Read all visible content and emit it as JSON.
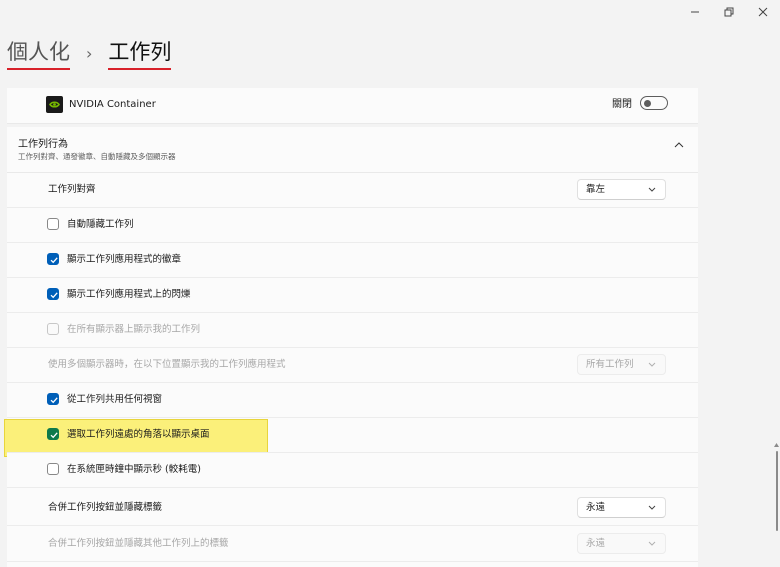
{
  "window": {
    "minimize_glyph": "–",
    "restore_glyph": "❐",
    "close_glyph": "✕"
  },
  "breadcrumb": {
    "parent": "個人化",
    "separator": "›",
    "current": "工作列"
  },
  "nvidia": {
    "label": "NVIDIA Container",
    "toggle_label": "關閉",
    "toggle_on": false,
    "icon": "nvidia-icon"
  },
  "behavior": {
    "title": "工作列行為",
    "subtitle": "工作列對齊、通發徽章、自動隱藏及多個顯示器",
    "expanded": true,
    "alignment": {
      "label": "工作列對齊",
      "value": "靠左"
    },
    "auto_hide": {
      "label": "自動隱藏工作列",
      "checked": false
    },
    "show_badges": {
      "label": "顯示工作列應用程式的徽章",
      "checked": true
    },
    "show_flashing": {
      "label": "顯示工作列應用程式上的閃爍",
      "checked": true
    },
    "all_displays": {
      "label": "在所有顯示器上顯示我的工作列",
      "checked": false,
      "disabled": true
    },
    "multi_display": {
      "label": "使用多個顯示器時，在以下位置顯示我的工作列應用程式",
      "value": "所有工作列",
      "disabled": true
    },
    "share_window": {
      "label": "從工作列共用任何視窗",
      "checked": true
    },
    "corner_desktop": {
      "label": "選取工作列遠處的角落以顯示桌面",
      "checked": true,
      "highlighted": true
    },
    "show_seconds": {
      "label": "在系統匣時鐘中顯示秒 (較耗電)",
      "checked": false
    },
    "combine_buttons": {
      "label": "合併工作列按鈕並隱藏標籤",
      "value": "永遠"
    },
    "combine_other": {
      "label": "合併工作列按鈕並隱藏其他工作列上的標籤",
      "value": "永遠",
      "disabled": true
    }
  },
  "colors": {
    "accent": "#005fb8",
    "highlight": "#fbf07a",
    "underline": "#d8212a"
  }
}
